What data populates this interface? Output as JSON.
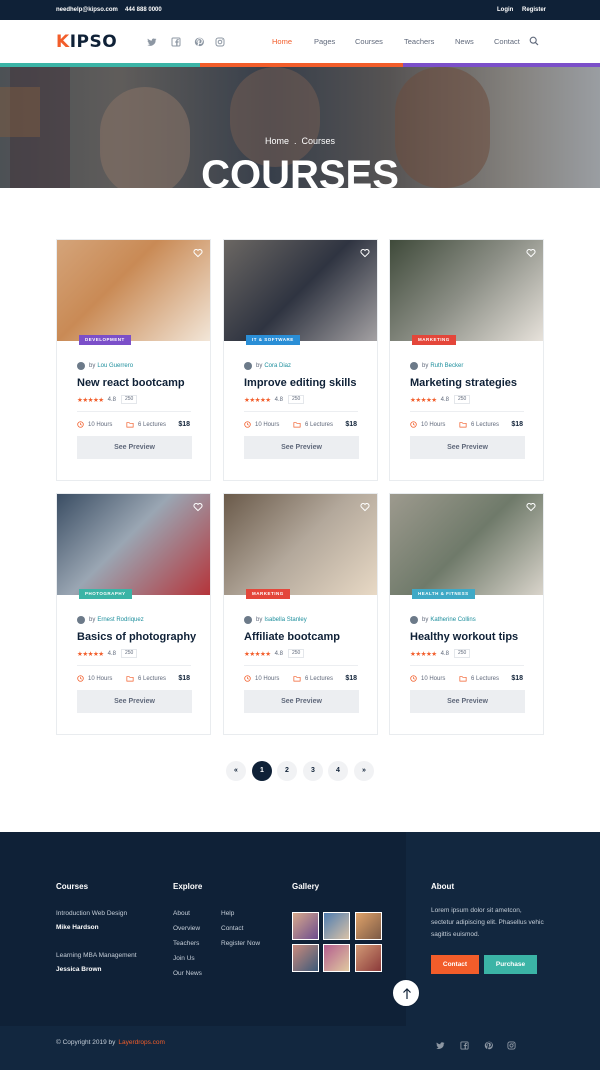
{
  "topbar": {
    "email": "needhelp@kipso.com",
    "phone": "444 888 0000",
    "login": "Login",
    "register": "Register"
  },
  "header": {
    "logo": "KIPSO",
    "social": [
      "twitter-icon",
      "facebook-icon",
      "pinterest-icon",
      "instagram-icon"
    ],
    "nav": [
      {
        "label": "Home",
        "active": true
      },
      {
        "label": "Pages"
      },
      {
        "label": "Courses"
      },
      {
        "label": "Teachers"
      },
      {
        "label": "News"
      },
      {
        "label": "Contact"
      }
    ]
  },
  "colors": {
    "accent": "#f25d2a",
    "teal": "#3bb4a6",
    "navy": "#0f2137",
    "purple": "#7b4fc9",
    "blue": "#2a8ed6",
    "red": "#e4463a",
    "green": "#3bb4a6",
    "lightblue": "#3fa9c6"
  },
  "hero": {
    "crumb_home": "Home",
    "crumb_sep": ".",
    "crumb_current": "Courses",
    "title": "COURSES"
  },
  "courses": [
    {
      "tag": "Development",
      "tag_color": "#7b4fc9",
      "author": "Lou Guerrero",
      "title": "New react bootcamp",
      "rating": "4.8",
      "reviews": "250",
      "hours": "10 Hours",
      "lectures": "6 Lectures",
      "price": "$18",
      "cta": "See Preview"
    },
    {
      "tag": "IT & Software",
      "tag_color": "#2a8ed6",
      "author": "Cora Diaz",
      "title": "Improve editing skills",
      "rating": "4.8",
      "reviews": "250",
      "hours": "10 Hours",
      "lectures": "6 Lectures",
      "price": "$18",
      "cta": "See Preview"
    },
    {
      "tag": "Marketing",
      "tag_color": "#e4463a",
      "author": "Ruth Becker",
      "title": "Marketing strategies",
      "rating": "4.8",
      "reviews": "250",
      "hours": "10 Hours",
      "lectures": "6 Lectures",
      "price": "$18",
      "cta": "See Preview"
    },
    {
      "tag": "Photography",
      "tag_color": "#3bb4a6",
      "author": "Ernest Rodriquez",
      "title": "Basics of photography",
      "rating": "4.8",
      "reviews": "250",
      "hours": "10 Hours",
      "lectures": "6 Lectures",
      "price": "$18",
      "cta": "See Preview"
    },
    {
      "tag": "Marketing",
      "tag_color": "#e4463a",
      "author": "Isabella Stanley",
      "title": "Affiliate bootcamp",
      "rating": "4.8",
      "reviews": "250",
      "hours": "10 Hours",
      "lectures": "6 Lectures",
      "price": "$18",
      "cta": "See Preview"
    },
    {
      "tag": "Health & Fitness",
      "tag_color": "#3fa9c6",
      "author": "Katherine Collins",
      "title": "Healthy workout tips",
      "rating": "4.8",
      "reviews": "250",
      "hours": "10 Hours",
      "lectures": "6 Lectures",
      "price": "$18",
      "cta": "See Preview"
    }
  ],
  "pagination": {
    "prev": "«",
    "pages": [
      "1",
      "2",
      "3",
      "4"
    ],
    "next": "»",
    "current": "1"
  },
  "footer": {
    "courses_heading": "Courses",
    "course1": "Introduction Web Design",
    "course1_author": "Mike Hardson",
    "course2": "Learning MBA Management",
    "course2_author": "Jessica Brown",
    "explore_heading": "Explore",
    "explore_col1": [
      "About",
      "Overview",
      "Teachers",
      "Join Us",
      "Our News"
    ],
    "explore_col2": [
      "Help",
      "Contact",
      "Register Now"
    ],
    "gallery_heading": "Gallery",
    "about_heading": "About",
    "about_text": "Lorem ipsum dolor sit ametcon, sectetur adipiscing elit. Phasellus vehic sagittis euismod.",
    "contact_btn": "Contact",
    "purchase_btn": "Purchase",
    "copyright": "© Copyright 2019 by",
    "brand": "Layerdrops.com"
  }
}
